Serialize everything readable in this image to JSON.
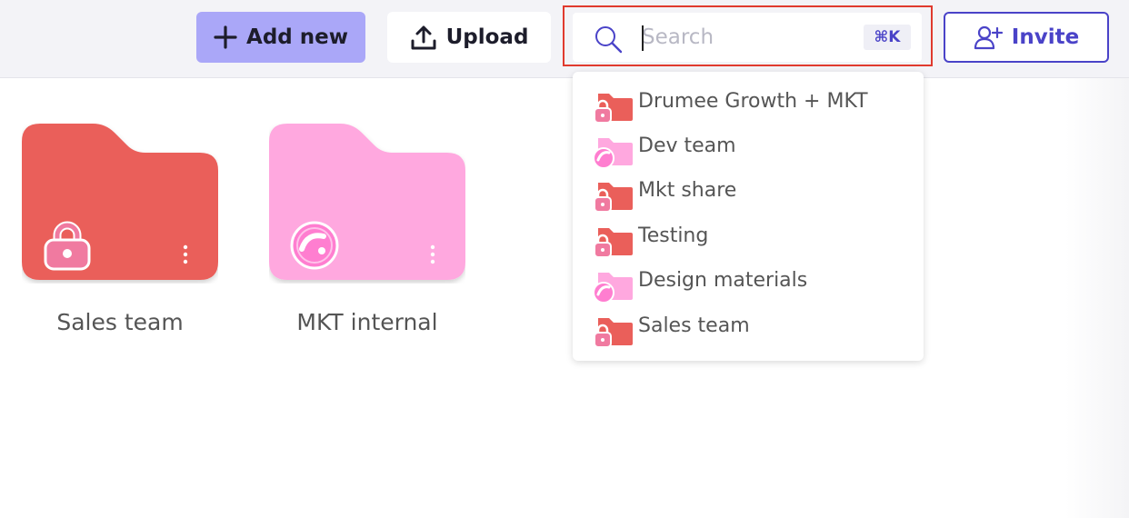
{
  "toolbar": {
    "add_new_label": "Add new",
    "upload_label": "Upload",
    "invite_label": "Invite",
    "search": {
      "placeholder": "Search",
      "value": "",
      "shortcut": "⌘K"
    }
  },
  "search_results": [
    {
      "label": "Drumee Growth + MKT",
      "icon": "private-folder-icon"
    },
    {
      "label": "Dev team",
      "icon": "shared-folder-icon"
    },
    {
      "label": "Mkt share",
      "icon": "private-folder-icon"
    },
    {
      "label": "Testing",
      "icon": "private-folder-icon"
    },
    {
      "label": "Design materials",
      "icon": "shared-folder-icon"
    },
    {
      "label": "Sales team",
      "icon": "private-folder-icon"
    }
  ],
  "folders": [
    {
      "label": "Sales team",
      "icon": "lock-icon"
    },
    {
      "label": "MKT internal",
      "icon": "shared-icon"
    }
  ],
  "colors": {
    "accent": "#4a43c8",
    "add_button": "#aaa7f8",
    "private_folder": "#ea5f5a",
    "shared_folder": "#ffa8df",
    "highlight": "#e03a2e"
  }
}
